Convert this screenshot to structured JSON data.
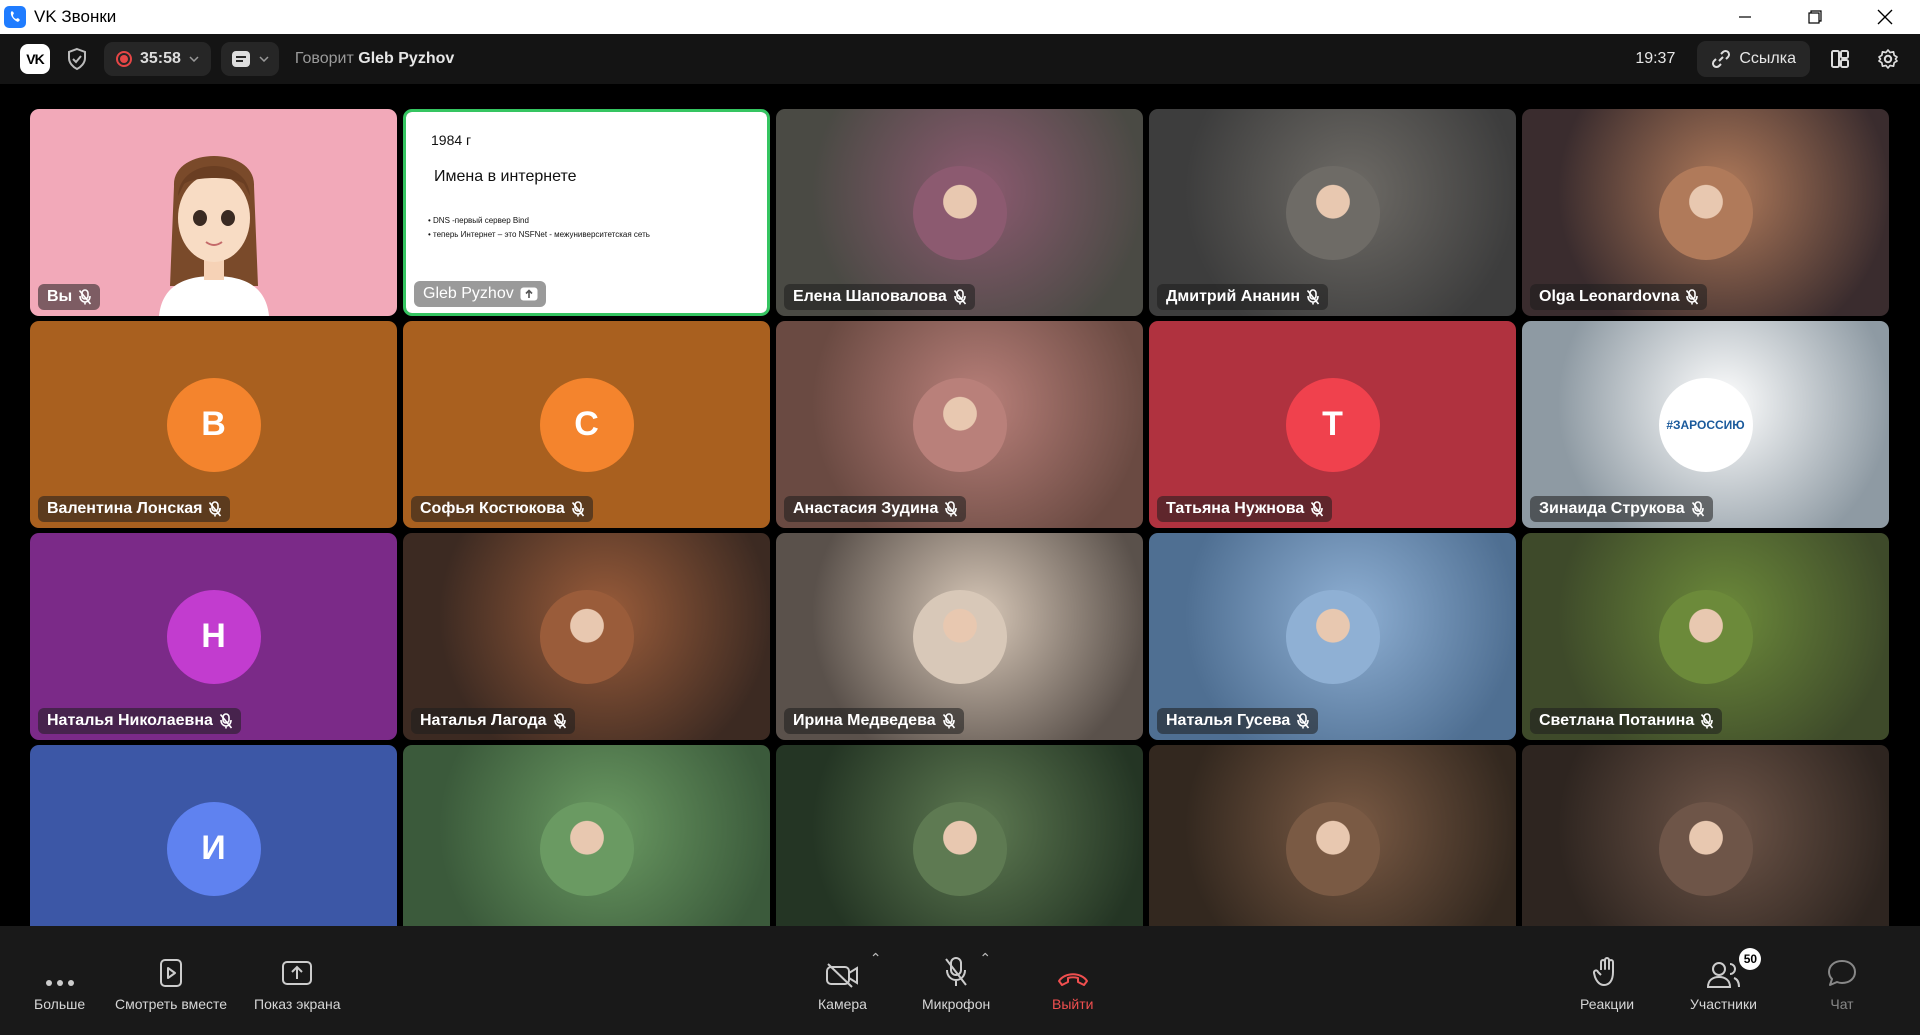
{
  "window": {
    "title": "VK Звонки"
  },
  "topbar": {
    "recording_time": "35:58",
    "speaking_label": "Говорит",
    "speaker_name": "Gleb Pyzhov",
    "clock": "19:37",
    "link_label": "Ссылка"
  },
  "slide": {
    "year": "1984 г",
    "title": "Имена в интернете",
    "bullet1": "• DNS -первый сервер Bind",
    "bullet2": "• теперь Интернет – это NSFNet - межуниверситетская сеть"
  },
  "participants": [
    {
      "name": "Вы",
      "kind": "self",
      "muted": true
    },
    {
      "name": "Gleb Pyzhov",
      "kind": "screen",
      "muted": false
    },
    {
      "name": "Елена Шаповалова",
      "kind": "photo",
      "muted": true,
      "bg": "#4a4a44",
      "avatar": "#8c5a70"
    },
    {
      "name": "Дмитрий Ананин",
      "kind": "photo",
      "muted": true,
      "bg": "#3d3d3d",
      "avatar": "#6e6b66"
    },
    {
      "name": "Olga Leonardovna",
      "kind": "photo",
      "muted": true,
      "bg": "#3a2c2e",
      "avatar": "#b07a5a"
    },
    {
      "name": "Валентина Лонская",
      "kind": "letter",
      "letter": "В",
      "muted": true,
      "bg": "#a9601f",
      "avatar": "#f4842d"
    },
    {
      "name": "Софья Костюкова",
      "kind": "letter",
      "letter": "С",
      "muted": true,
      "bg": "#a9601f",
      "avatar": "#f4842d"
    },
    {
      "name": "Анастасия Зудина",
      "kind": "photo",
      "muted": true,
      "bg": "#6a4a42",
      "avatar": "#b9807a"
    },
    {
      "name": "Татьяна Нужнова",
      "kind": "letter",
      "letter": "Т",
      "muted": true,
      "bg": "#b0323f",
      "avatar": "#f0414d"
    },
    {
      "name": "Зинаида Струкова",
      "kind": "logo",
      "logo_text": "#ЗАРОССИЮ",
      "muted": true,
      "bg": "#8e9aa3",
      "avatar": "#ffffff"
    },
    {
      "name": "Наталья Николаевна",
      "kind": "letter",
      "letter": "Н",
      "muted": true,
      "bg": "#7b2a88",
      "avatar": "#c23ccf"
    },
    {
      "name": "Наталья Лагода",
      "kind": "photo",
      "muted": true,
      "bg": "#3c2a22",
      "avatar": "#9a5c3a"
    },
    {
      "name": "Ирина Медведева",
      "kind": "photo",
      "muted": true,
      "bg": "#5a514b",
      "avatar": "#d8c8b8"
    },
    {
      "name": "Наталья Гусева",
      "kind": "photo",
      "muted": true,
      "bg": "#4f6f92",
      "avatar": "#8fb0d4"
    },
    {
      "name": "Светлана Потанина",
      "kind": "photo",
      "muted": true,
      "bg": "#3e4a2a",
      "avatar": "#6c8a3a"
    },
    {
      "name": "",
      "kind": "letter",
      "letter": "И",
      "muted": true,
      "bg": "#3c57a6",
      "avatar": "#5f82f0"
    },
    {
      "name": "",
      "kind": "photo",
      "muted": true,
      "bg": "#3b5a3b",
      "avatar": "#6a9a62"
    },
    {
      "name": "",
      "kind": "photo",
      "muted": true,
      "bg": "#243524",
      "avatar": "#5e7a52"
    },
    {
      "name": "",
      "kind": "photo",
      "muted": true,
      "bg": "#33281f",
      "avatar": "#7a5a44"
    },
    {
      "name": "",
      "kind": "photo",
      "muted": true,
      "bg": "#2e2520",
      "avatar": "#6e5548"
    }
  ],
  "toolbar": {
    "more": "Больше",
    "watch_together": "Смотреть вместе",
    "screen_share": "Показ экрана",
    "camera": "Камера",
    "microphone": "Микрофон",
    "leave": "Выйти",
    "reactions": "Реакции",
    "participants": "Участники",
    "participants_count": "50",
    "chat": "Чат"
  },
  "colors": {
    "active_speaker_border": "#35c561",
    "leave": "#f04f4f",
    "recording": "#e64646"
  },
  "icons": {
    "mic_off": "mic-off-icon",
    "screen_share": "screen-share-icon"
  }
}
